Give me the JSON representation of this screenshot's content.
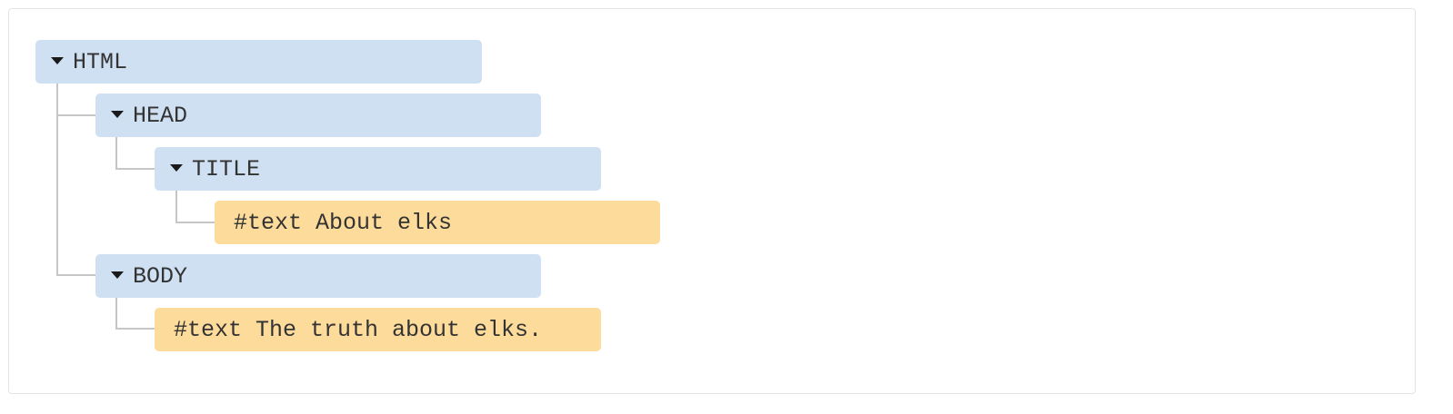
{
  "tree": {
    "html": {
      "label": "HTML"
    },
    "head": {
      "label": "HEAD"
    },
    "title": {
      "label": "TITLE"
    },
    "title_text": {
      "label": "#text About elks"
    },
    "body": {
      "label": "BODY"
    },
    "body_text": {
      "label": "#text The truth about elks."
    }
  },
  "colors": {
    "element_node": "#cfe0f2",
    "text_node": "#fddb9b",
    "connector": "#c6c6c6",
    "frame_border": "#e4e4e4"
  },
  "icons": {
    "expanded": "triangle-down-icon"
  }
}
